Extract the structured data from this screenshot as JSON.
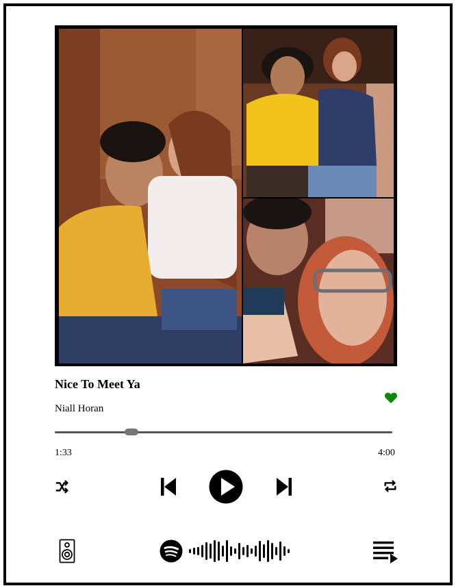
{
  "song": {
    "title": "Nice To Meet Ya",
    "artist": "Niall Horan",
    "liked": true
  },
  "progress": {
    "elapsed": "1:33",
    "total": "4:00",
    "fraction": 0.2275
  },
  "controls": {
    "shuffle_icon": "shuffle-icon",
    "previous_icon": "skip-previous-icon",
    "play_icon": "play-icon",
    "next_icon": "skip-next-icon",
    "repeat_icon": "repeat-icon"
  },
  "footer": {
    "speaker_icon": "speaker-icon",
    "spotify_icon": "spotify-logo-icon",
    "code_icon": "spotify-code",
    "queue_icon": "queue-icon"
  },
  "colors": {
    "heart": "#0a8a0a",
    "frame": "#000000"
  }
}
